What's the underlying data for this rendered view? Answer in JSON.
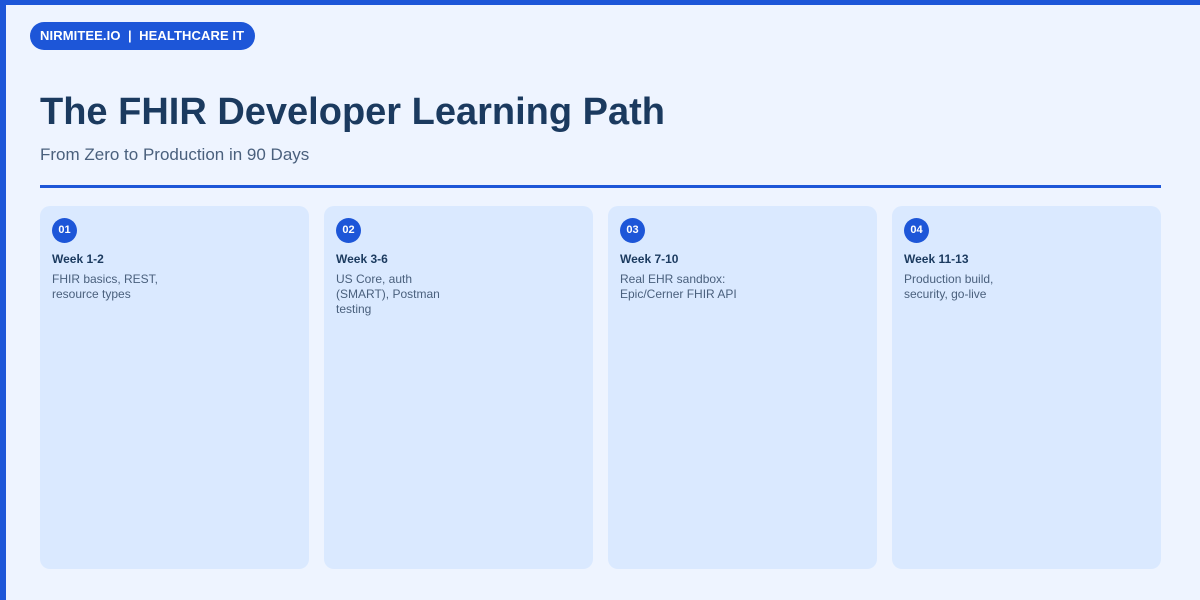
{
  "brand": {
    "label": "NIRMITEE.IO  |  HEALTHCARE IT"
  },
  "header": {
    "title": "The FHIR Developer Learning Path",
    "subtitle": "From Zero to Production in 90 Days"
  },
  "colors": {
    "accent": "#1d56d8",
    "background": "#eef4ff",
    "card": "#dae9ff",
    "title": "#1b3a5f",
    "body_text": "#4a607d"
  },
  "stages": [
    {
      "number": "01",
      "week": "Week 1-2",
      "description": "FHIR basics, REST, resource types"
    },
    {
      "number": "02",
      "week": "Week 3-6",
      "description": "US Core, auth (SMART), Postman testing"
    },
    {
      "number": "03",
      "week": "Week 7-10",
      "description": "Real EHR sandbox: Epic/Cerner FHIR API"
    },
    {
      "number": "04",
      "week": "Week 11-13",
      "description": "Production build, security, go-live"
    }
  ]
}
